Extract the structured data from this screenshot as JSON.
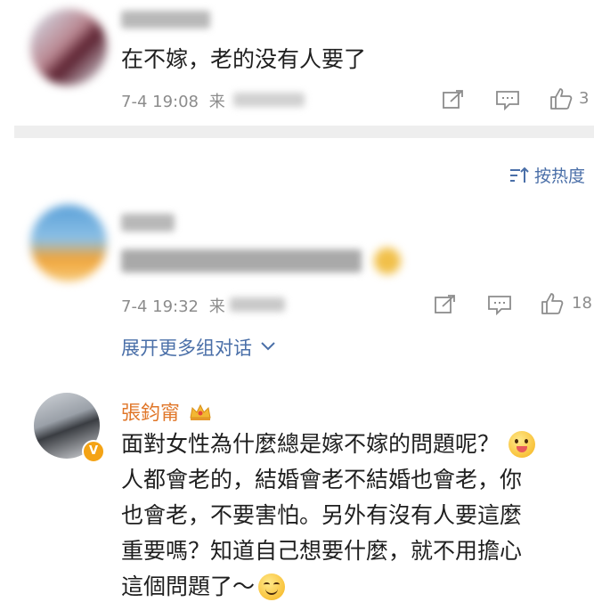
{
  "comment1": {
    "text": "在不嫁，老的没有人要了",
    "time": "7-4 19:08",
    "source_prefix": "来",
    "like_count": "3"
  },
  "sort": {
    "label": "按热度",
    "icon": "sort-icon"
  },
  "comment2": {
    "time": "7-4 19:32",
    "source_prefix": "来",
    "like_count": "18",
    "expand_label": "展开更多组对话",
    "expand_icon": "chevron-down-icon"
  },
  "reply": {
    "author": "張鈞甯",
    "verified_badge": "V",
    "lines": [
      "面對女性為什麼總是嫁不嫁的問題呢？",
      "人都會老的，結婚會老不結婚也會老，你",
      "也會老，不要害怕。另外有沒有人要這麼",
      "重要嗎？知道自己想要什麼，就不用擔心",
      "這個問題了～"
    ]
  },
  "colors": {
    "link": "#4a6fa8",
    "meta": "#8c8c8c",
    "divider": "#eeeeee",
    "verified": "#f4a315",
    "crown": "#f3a633"
  }
}
